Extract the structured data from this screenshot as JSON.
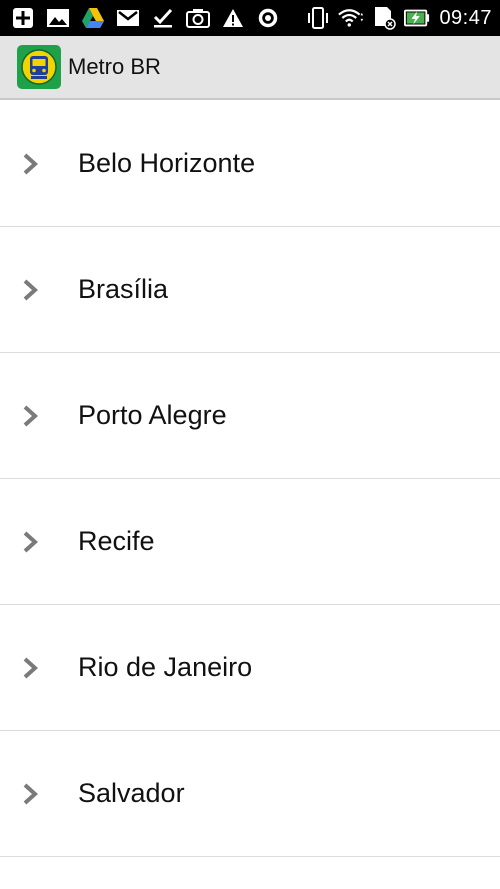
{
  "status_bar": {
    "left_icons": [
      "add-icon",
      "image-icon",
      "drive-icon",
      "gmail-icon",
      "check-icon",
      "camera-icon",
      "warning-icon",
      "sync-icon"
    ],
    "right_icons": [
      "vibrate-icon",
      "wifi-icon",
      "sd-card-icon",
      "battery-charging-icon"
    ],
    "time": "09:47"
  },
  "action_bar": {
    "title": "Metro BR",
    "icon": "metro-train-icon",
    "colors": {
      "icon_bg": "#1fa14a",
      "icon_circle": "#f2d400",
      "train": "#1f3f99"
    }
  },
  "cities": [
    {
      "label": "Belo Horizonte",
      "icon": "chevron-right-icon"
    },
    {
      "label": "Brasília",
      "icon": "chevron-right-icon"
    },
    {
      "label": "Porto Alegre",
      "icon": "chevron-right-icon"
    },
    {
      "label": "Recife",
      "icon": "chevron-right-icon"
    },
    {
      "label": "Rio de Janeiro",
      "icon": "chevron-right-icon"
    },
    {
      "label": "Salvador",
      "icon": "chevron-right-icon"
    }
  ]
}
